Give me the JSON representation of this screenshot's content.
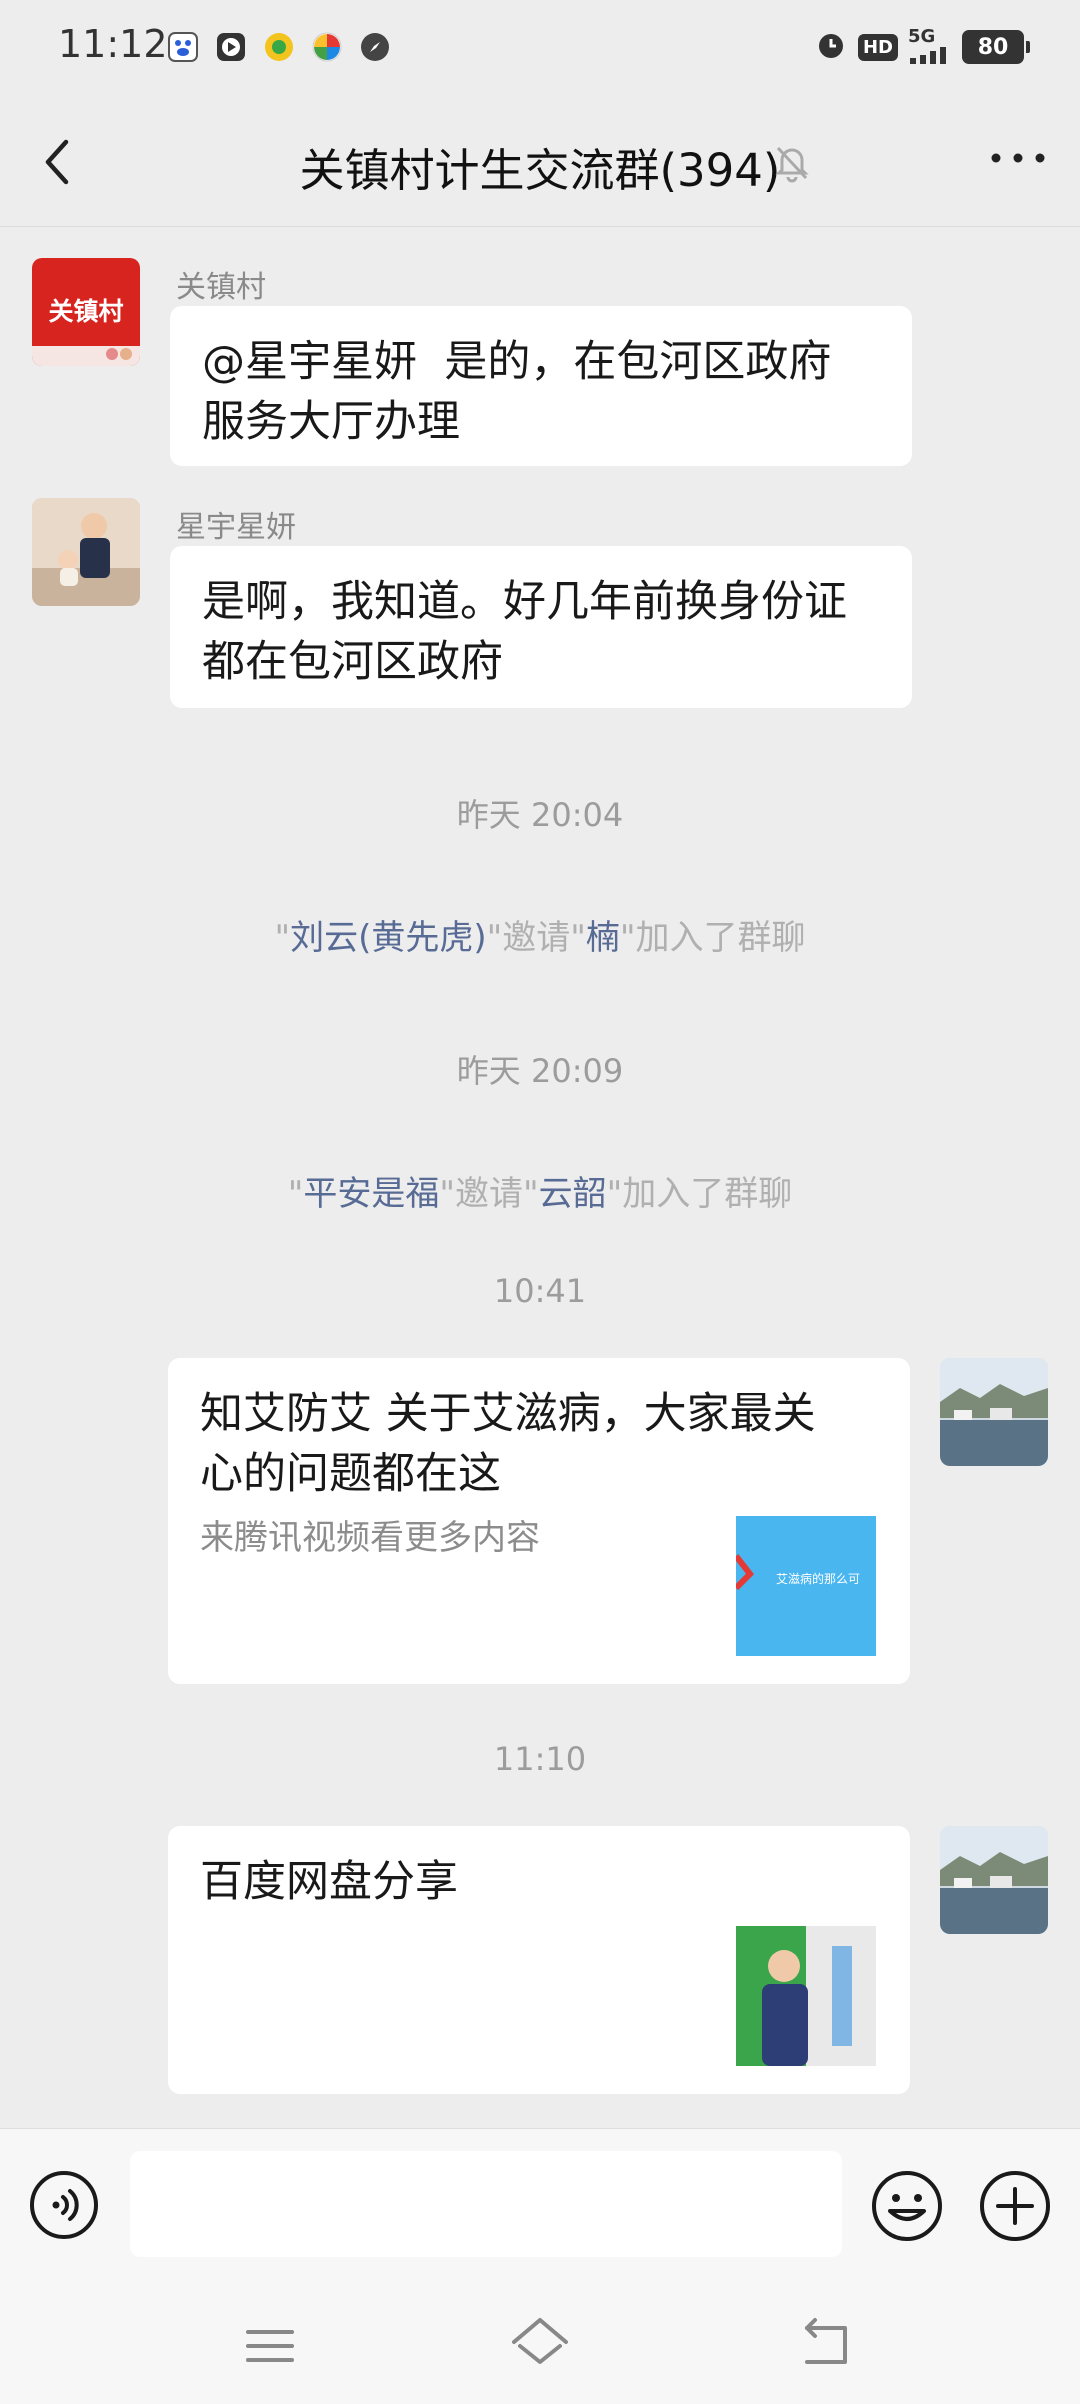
{
  "status_bar": {
    "time": "11:12",
    "network": "5G",
    "hd": "HD",
    "battery": "80",
    "left_icons": [
      "baidu-app-icon",
      "video-app-icon",
      "lottery-app-icon",
      "pinwheel-app-icon",
      "compass-app-icon"
    ],
    "right_icons": [
      "alarm-icon",
      "hd-icon",
      "signal-icon",
      "battery-icon"
    ]
  },
  "header": {
    "title": "关镇村计生交流群(394)"
  },
  "messages": [
    {
      "type": "text",
      "sender": "关镇村",
      "avatar_text": "关镇村",
      "text_line1": "@星宇星妍  是的，在包河区政府",
      "text_line2": "服务大厅办理"
    },
    {
      "type": "text",
      "sender": "星宇星妍",
      "text_line1": "是啊，我知道。好几年前换身份证",
      "text_line2": "都在包河区政府"
    }
  ],
  "timestamps": [
    "昨天 20:04",
    "昨天 20:09",
    "10:41",
    "11:10"
  ],
  "system_messages": [
    {
      "q1": "\"",
      "inviter": "刘云(黄先虎)",
      "q2": "\"邀请\"",
      "invitee": "楠",
      "q3": "\"加入了群聊"
    },
    {
      "q1": "\"",
      "inviter": "平安是福",
      "q2": "\"邀请\"",
      "invitee": "云韶",
      "q3": "\"加入了群聊"
    }
  ],
  "cards": [
    {
      "title_line1": "知艾防艾 关于艾滋病，大家最关",
      "title_line2": "心的问题都在这",
      "subtitle": "来腾讯视频看更多内容",
      "thumb_caption": "艾滋病的那么可"
    },
    {
      "title_line1": "百度网盘分享"
    }
  ],
  "colors": {
    "background": "#ededed",
    "bubble": "#ffffff",
    "link_name": "#576b95",
    "system_text": "#b0b0b0",
    "timestamp": "#9c9c9c"
  }
}
